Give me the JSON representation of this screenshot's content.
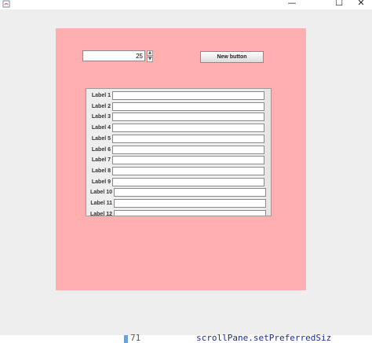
{
  "window": {
    "minimize_glyph": "—",
    "maximize_glyph": "☐",
    "close_glyph": "✕"
  },
  "spinner": {
    "value": "25",
    "up_glyph": "▲",
    "down_glyph": "▼"
  },
  "new_button": {
    "label": "New button"
  },
  "form": {
    "labels": [
      "Label 1",
      "Label 2",
      "Label 3",
      "Label 4",
      "Label 5",
      "Label 6",
      "Label 7",
      "Label 8",
      "Label 9",
      "Label 10",
      "Label 11",
      "Label 12"
    ]
  },
  "editor_behind": {
    "line_number": "71",
    "code": "scrollPane.setPreferredSiz"
  },
  "colors": {
    "panel_bg": "#ffafaf",
    "window_bg": "#eeeeee"
  }
}
